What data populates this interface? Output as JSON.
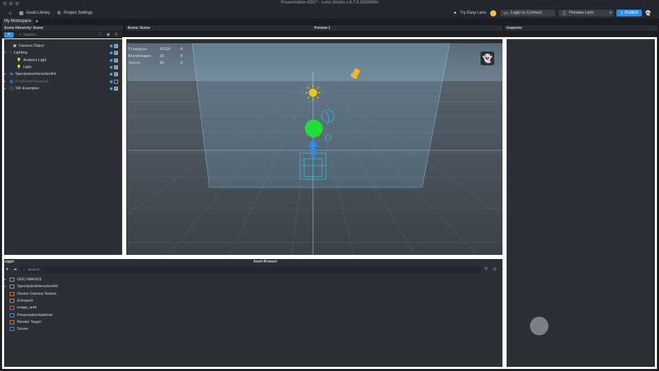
{
  "window": {
    "title": "Presentation-GDC* - Lens Studio v.5.7.0.25030504"
  },
  "toolbar": {
    "asset_library": "Asset Library",
    "project_settings": "Project Settings",
    "try_easy_lens": "Try Easy Lens",
    "login": "Login to Connect",
    "preview_lens": "Preview Lens",
    "publish": "Publish"
  },
  "workspace": {
    "tab": "My Workspace"
  },
  "panels": {
    "hierarchy_title": "Scene Hierarchy: Scene",
    "scene_title": "Scene: Scene",
    "preview_title": "Preview 1",
    "inspector_title": "Inspector",
    "logger_title": "Logger",
    "asset_browser_title": "Asset Browser"
  },
  "hierarchy": {
    "search_placeholder": "Search...",
    "items": [
      {
        "label": "Camera Object",
        "indent": 1,
        "expanded": null,
        "icon": "camera-icon",
        "visible": true
      },
      {
        "label": "Lighting",
        "indent": 0,
        "expanded": true,
        "icon": "light-group-icon",
        "visible": true
      },
      {
        "label": "Ambient Light",
        "indent": 2,
        "expanded": null,
        "icon": "bulb-icon",
        "visible": true
      },
      {
        "label": "Light",
        "indent": 2,
        "expanded": null,
        "icon": "bulb-icon",
        "visible": true
      },
      {
        "label": "SpectaclesInteractionKit",
        "indent": 0,
        "expanded": false,
        "icon": "prefab-icon",
        "visible": true
      },
      {
        "label": "[ContainerFrameUI]",
        "indent": 0,
        "expanded": false,
        "icon": "prefab-icon",
        "visible": false
      },
      {
        "label": "SIK Examples",
        "indent": 0,
        "expanded": false,
        "icon": "object-icon",
        "visible": true
      }
    ]
  },
  "scene_stats": [
    {
      "name": "Triangles",
      "value": "97216",
      "extra": "0"
    },
    {
      "name": "Blendshapes",
      "value": "16",
      "extra": "0"
    },
    {
      "name": "Joints",
      "value": "82",
      "extra": "0"
    }
  ],
  "asset_browser": {
    "search_placeholder": "Search...",
    "items": [
      {
        "label": "GDC-IMAGES",
        "expandable": true,
        "icon": "folder-icon",
        "color": "#9aa0a8"
      },
      {
        "label": "SpectaclesInteractionKit",
        "expandable": true,
        "icon": "package-icon",
        "color": "#9aa0a8"
      },
      {
        "label": "Device Camera Texture",
        "expandable": false,
        "icon": "texture-icon",
        "color": "#e07a2f"
      },
      {
        "label": "Echopark",
        "expandable": false,
        "icon": "image-icon",
        "color": "#b98a6a"
      },
      {
        "label": "image_until",
        "expandable": false,
        "icon": "image-icon",
        "color": "#c65a7a"
      },
      {
        "label": "PresentationSwitcher",
        "expandable": false,
        "icon": "script-icon",
        "color": "#4a90e2"
      },
      {
        "label": "Render Target",
        "expandable": false,
        "icon": "render-target-icon",
        "color": "#e07a2f"
      },
      {
        "label": "Scene",
        "expandable": false,
        "icon": "scene-icon",
        "color": "#4a90e2"
      }
    ]
  },
  "colors": {
    "accent": "#2f8fe8",
    "highlight_border": "#ffffff",
    "sphere_green": "#22dd33",
    "gizmo_cyan": "#29c6e6"
  }
}
